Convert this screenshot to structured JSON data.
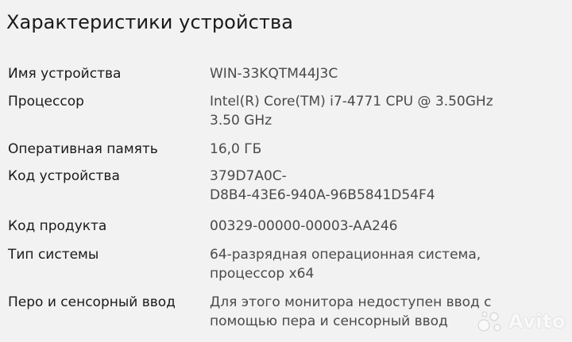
{
  "page": {
    "title": "Характеристики устройства"
  },
  "specs": [
    {
      "label": "Имя устройства",
      "value_lines": [
        "WIN-33KQTM44J3C"
      ]
    },
    {
      "label": "Процессор",
      "value_lines": [
        "Intel(R) Core(TM) i7-4771 CPU @ 3.50GHz",
        "3.50 GHz"
      ]
    },
    {
      "label": "Оперативная память",
      "value_lines": [
        "16,0 ГБ"
      ]
    },
    {
      "label": "Код устройства",
      "value_lines": [
        "379D7A0C-",
        "D8B4-43E6-940A-96B5841D54F4"
      ]
    },
    {
      "label": "Код продукта",
      "value_lines": [
        "00329-00000-00003-AA246"
      ]
    },
    {
      "label": "Тип системы",
      "value_lines": [
        "64-разрядная операционная система,",
        "процессор x64"
      ]
    },
    {
      "label": "Перо и сенсорный ввод",
      "value_lines": [
        "Для этого монитора недоступен ввод с",
        "помощью пера и сенсорный ввод"
      ]
    }
  ],
  "watermark": {
    "text": "Avito",
    "icon": "avito-dots-icon"
  }
}
